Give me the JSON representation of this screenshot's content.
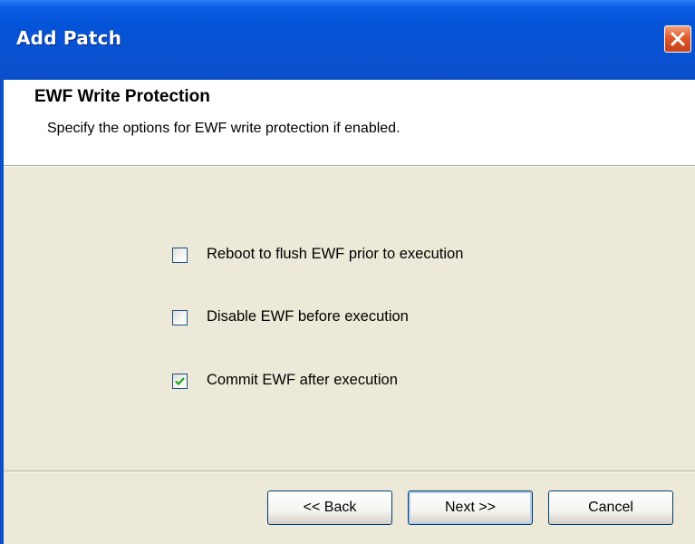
{
  "window": {
    "title": "Add Patch"
  },
  "header": {
    "title": "EWF Write Protection",
    "subtitle": "Specify the options for EWF write protection if enabled."
  },
  "options": [
    {
      "label": "Reboot to flush EWF prior to execution",
      "checked": false
    },
    {
      "label": "Disable EWF before execution",
      "checked": false
    },
    {
      "label": "Commit EWF after execution",
      "checked": true
    }
  ],
  "buttons": {
    "back": "<< Back",
    "next": "Next >>",
    "cancel": "Cancel"
  },
  "icons": {
    "close": "close-icon",
    "check": "checkmark-icon"
  },
  "colors": {
    "titlebar": "#0553d6",
    "close": "#e2582a",
    "dialog_bg": "#ece9d8",
    "checkmark": "#21a121"
  }
}
